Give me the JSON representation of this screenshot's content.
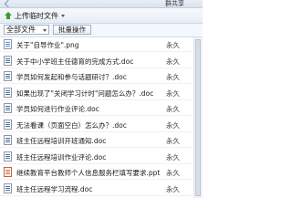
{
  "header": {
    "group_share_label": "群共享"
  },
  "toolbar": {
    "upload_label": "上传临时文件",
    "filter_selected": "全部文件",
    "batch_label": "批量操作"
  },
  "files": [
    {
      "name": "关于\"自导作业\".png",
      "expiry": "永久",
      "type": "png"
    },
    {
      "name": "关于中小学班主任德育的完成方式.doc",
      "expiry": "永久",
      "type": "doc"
    },
    {
      "name": "学员如何发起和参与话题研讨？.doc",
      "expiry": "永久",
      "type": "doc"
    },
    {
      "name": "如果出现了\"关闭学习计时\"问题怎么办？.doc",
      "expiry": "永久",
      "type": "doc"
    },
    {
      "name": "学员如何进行作业评论.doc",
      "expiry": "永久",
      "type": "doc"
    },
    {
      "name": "无法看课（页面空白）怎么办？.doc",
      "expiry": "永久",
      "type": "doc"
    },
    {
      "name": "班主任远程培训开班通知.doc",
      "expiry": "永久",
      "type": "doc"
    },
    {
      "name": "班主任远程培训作业评论.doc",
      "expiry": "永久",
      "type": "doc"
    },
    {
      "name": "继续教育平台教师个人信息服务栏填写要求.ppt",
      "expiry": "永久",
      "type": "ppt"
    },
    {
      "name": "班主任远程学习流程.doc",
      "expiry": "永久",
      "type": "doc"
    }
  ]
}
